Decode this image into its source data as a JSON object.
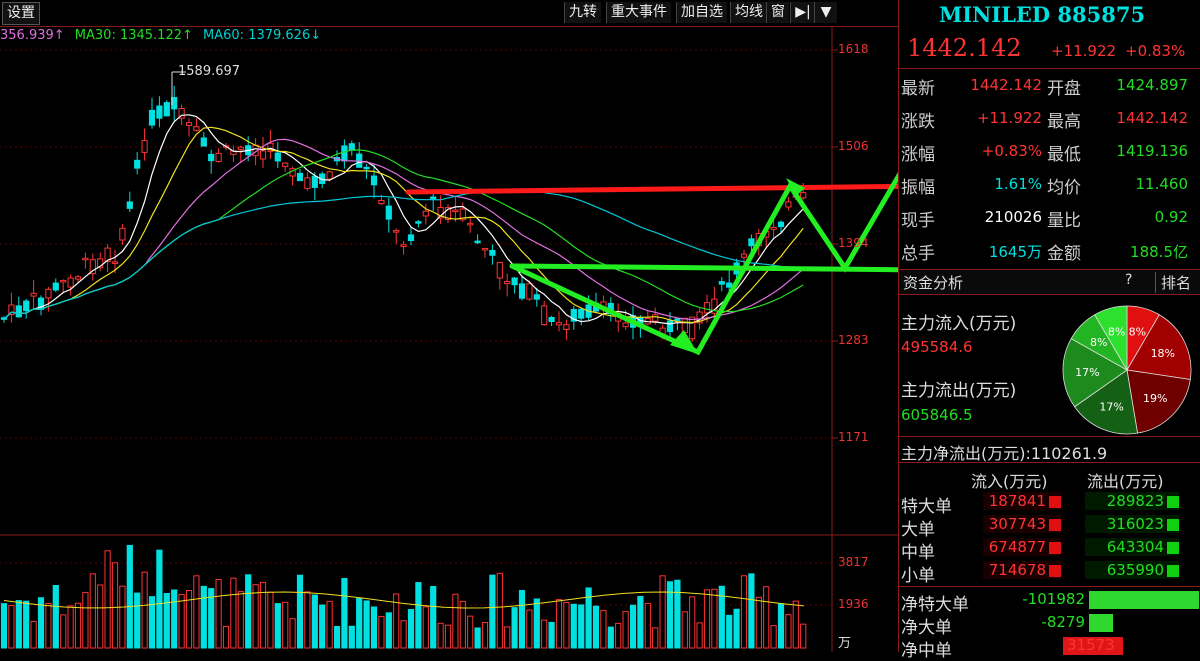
{
  "toolbar": {
    "settings": "设置",
    "buttons": [
      "九转",
      "重大事件",
      "加自选",
      "均线",
      "窗"
    ]
  },
  "ma_legend": {
    "ma20": "356.939↑",
    "ma30": "MA30: 1345.122↑",
    "ma60": "MA60: 1379.626↓"
  },
  "price_axis": [
    "1618",
    "1506",
    "1394",
    "1283",
    "1171"
  ],
  "volume_axis": [
    "3817",
    "1936"
  ],
  "volume_unit": "万",
  "peak_label": "1589.697",
  "colors": {
    "up": "#ff3333",
    "down": "#00e0e0",
    "arrow_red": "#ff1a1a",
    "arrow_green": "#22ee22"
  },
  "quote": {
    "title": "MINILED 885875",
    "price": "1442.142",
    "change": "+11.922",
    "change_pct": "+0.83%",
    "rows": [
      {
        "l1": "最新",
        "v1": "1442.142",
        "c1": "red",
        "l2": "开盘",
        "v2": "1424.897",
        "c2": "green"
      },
      {
        "l1": "涨跌",
        "v1": "+11.922",
        "c1": "red",
        "l2": "最高",
        "v2": "1442.142",
        "c2": "red"
      },
      {
        "l1": "涨幅",
        "v1": "+0.83%",
        "c1": "red",
        "l2": "最低",
        "v2": "1419.136",
        "c2": "green"
      },
      {
        "l1": "振幅",
        "v1": "1.61%",
        "c1": "cyan",
        "l2": "均价",
        "v2": "11.460",
        "c2": "green"
      },
      {
        "l1": "现手",
        "v1": "210026",
        "c1": "white",
        "l2": "量比",
        "v2": "0.92",
        "c2": "green"
      },
      {
        "l1": "总手",
        "v1": "1645万",
        "c1": "cyan",
        "l2": "金额",
        "v2": "188.5亿",
        "c2": "green"
      }
    ]
  },
  "fund": {
    "header": "资金分析",
    "help": "?",
    "rank": "排名",
    "inflow_label": "主力流入(万元)",
    "inflow_value": "495584.6",
    "outflow_label": "主力流出(万元)",
    "outflow_value": "605846.5",
    "net_label": "主力净流出(万元):",
    "net_value": "110261.9",
    "pie": [
      "8%",
      "18%",
      "19%",
      "17%",
      "17%",
      "8%",
      "8%"
    ],
    "col_in": "流入(万元)",
    "col_out": "流出(万元)",
    "flows": [
      {
        "name": "特大单",
        "in": "187841",
        "out": "289823"
      },
      {
        "name": "大单",
        "in": "307743",
        "out": "316023"
      },
      {
        "name": "中单",
        "in": "674877",
        "out": "643304"
      },
      {
        "name": "小单",
        "in": "714678",
        "out": "635990"
      }
    ],
    "net": [
      {
        "name": "净特大单",
        "value": "-101982"
      },
      {
        "name": "净大单",
        "value": "-8279"
      },
      {
        "name": "净中单",
        "value": "31573"
      }
    ]
  }
}
